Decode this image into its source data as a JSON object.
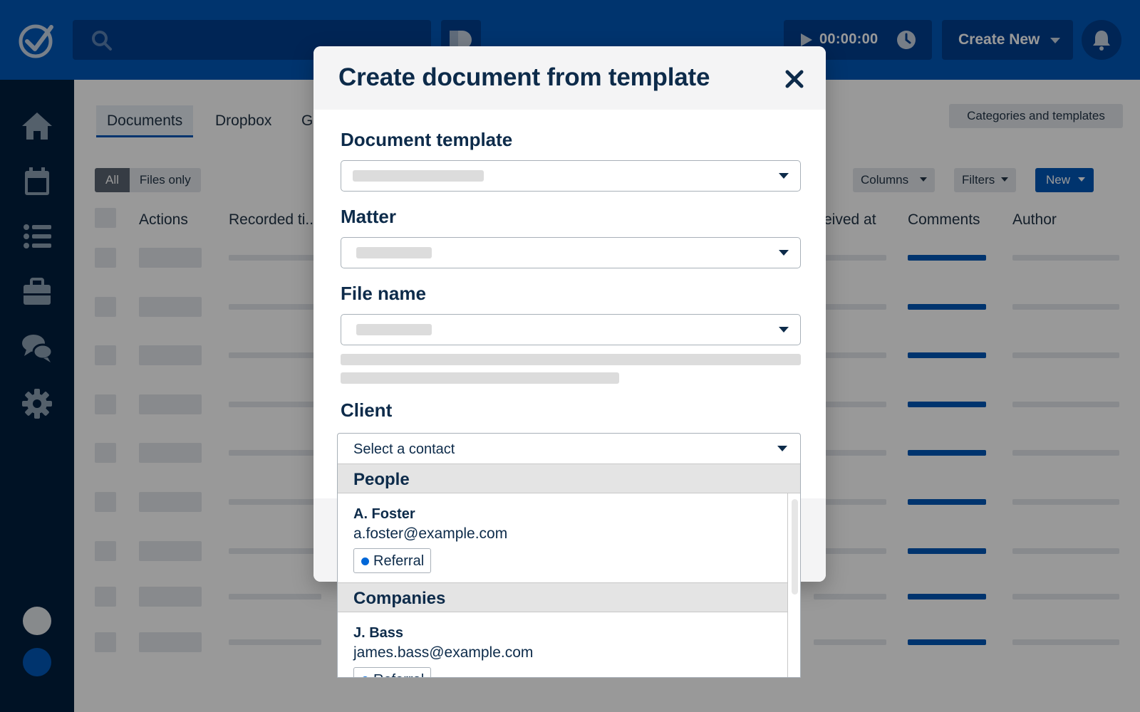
{
  "topbar": {
    "timer": "00:00:00",
    "create_new": "Create New"
  },
  "tabs": [
    "Documents",
    "Dropbox",
    "G"
  ],
  "toolbar": {
    "categories_and_templates": "Categories and templates",
    "filter_all": "All",
    "filter_files_only": "Files only",
    "columns": "Columns",
    "filters": "Filters",
    "new": "New"
  },
  "table": {
    "columns": [
      "Actions",
      "Recorded ti...",
      "eived at",
      "Comments",
      "Author"
    ]
  },
  "modal": {
    "title": "Create document from template",
    "fields": {
      "document_template": "Document template",
      "matter": "Matter",
      "file_name": "File name",
      "client": "Client"
    },
    "client_select_value": "Select a contact",
    "dropdown": {
      "groups": [
        {
          "label": "People",
          "options": [
            {
              "name": "A. Foster",
              "email": "a.foster@example.com",
              "tag": "Referral"
            }
          ]
        },
        {
          "label": "Companies",
          "options": [
            {
              "name": "J. Bass",
              "email": "james.bass@example.com",
              "tag": "Referral"
            }
          ]
        }
      ]
    }
  },
  "colors": {
    "brand_blue": "#0058b8",
    "nav_dark": "#001f3f",
    "tag_dot": "#0067d8"
  },
  "icons": [
    "logo-check-icon",
    "search-icon",
    "play-icon",
    "clock-icon",
    "caret-down-icon",
    "bell-icon",
    "home-icon",
    "calendar-icon",
    "list-icon",
    "briefcase-icon",
    "chat-icon",
    "gear-icon",
    "close-icon"
  ]
}
